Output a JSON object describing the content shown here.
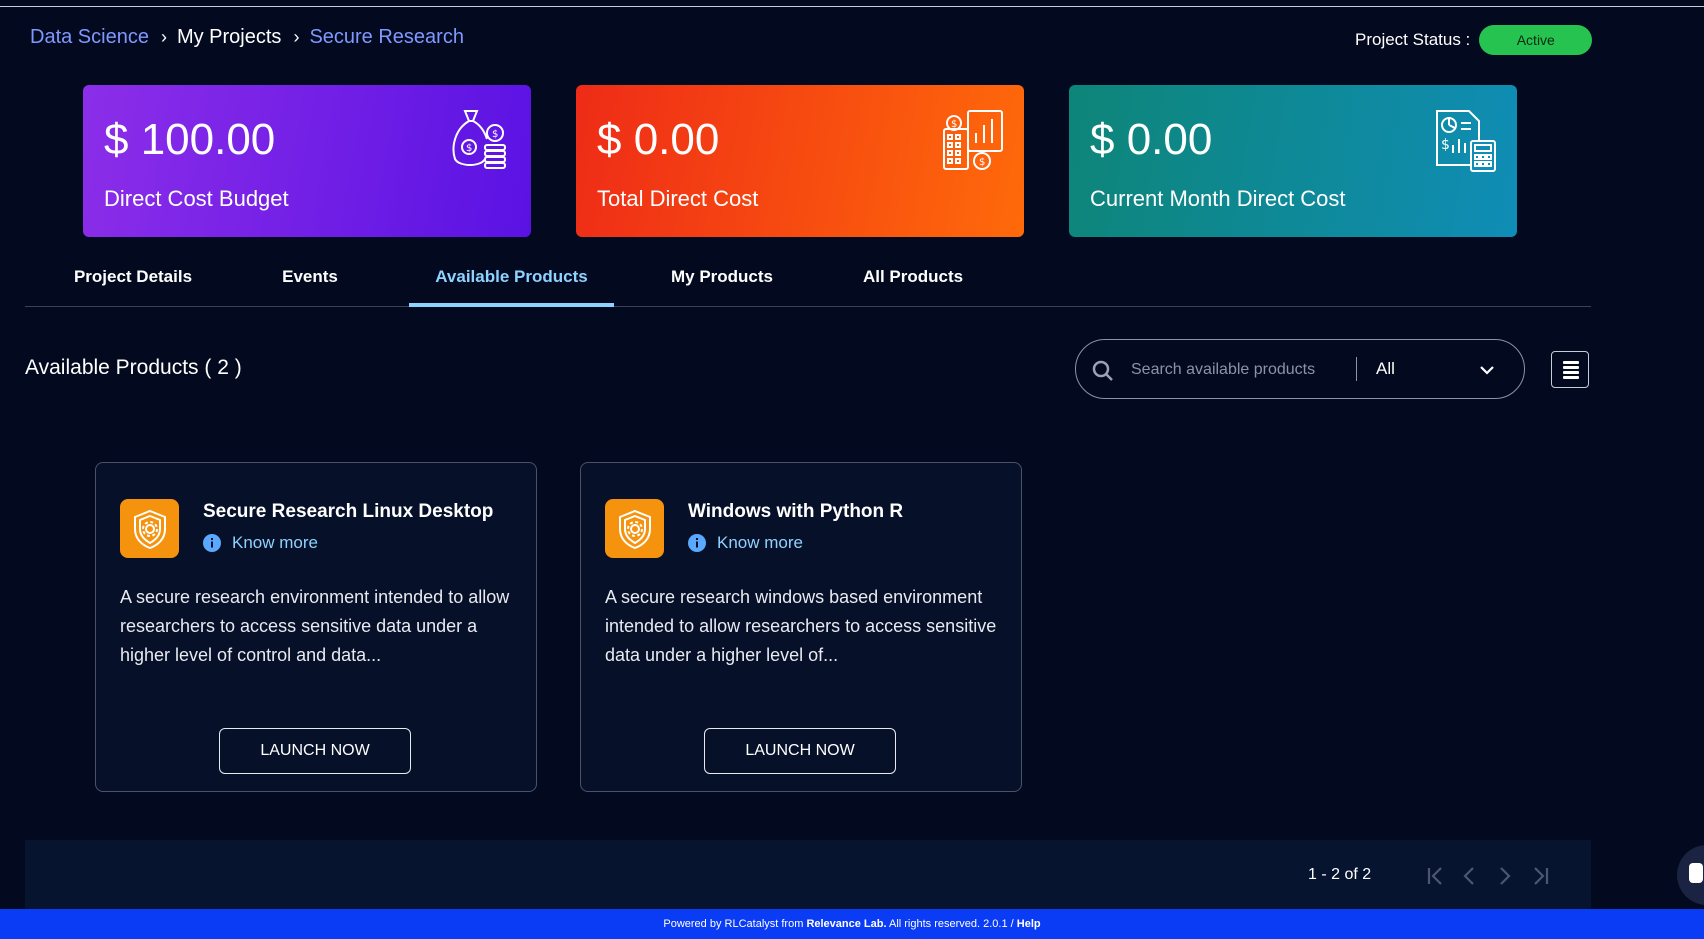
{
  "breadcrumb": {
    "item1": "Data Science",
    "item2": "My Projects",
    "item3": "Secure Research"
  },
  "status": {
    "label": "Project Status :",
    "value": "Active"
  },
  "cost_cards": [
    {
      "amount": "$ 100.00",
      "label": "Direct Cost Budget",
      "icon": "money-bag-coins-icon"
    },
    {
      "amount": "$ 0.00",
      "label": "Total Direct Cost",
      "icon": "cost-chart-building-icon"
    },
    {
      "amount": "$ 0.00",
      "label": "Current Month Direct Cost",
      "icon": "report-calculator-icon"
    }
  ],
  "tabs": [
    {
      "label": "Project Details"
    },
    {
      "label": "Events"
    },
    {
      "label": "Available Products",
      "active": true
    },
    {
      "label": "My Products"
    },
    {
      "label": "All Products"
    }
  ],
  "section": {
    "title": "Available Products ( 2 )"
  },
  "search": {
    "placeholder": "Search available products",
    "value": "",
    "filter_value": "All"
  },
  "products": [
    {
      "name": "Secure Research Linux Desktop",
      "know_more": "Know more",
      "description": "A secure research environment intended to allow researchers to access sensitive data under a higher level of control and data...",
      "launch_label": "LAUNCH NOW"
    },
    {
      "name": "Windows with Python R",
      "know_more": "Know more",
      "description": "A secure research windows based environment intended to allow researchers to access sensitive data under a higher level of...",
      "launch_label": "LAUNCH NOW"
    }
  ],
  "pagination": {
    "range": "1 - 2 of 2"
  },
  "footer": {
    "prefix": "Powered by RLCatalyst from ",
    "company": "Relevance Lab.",
    "suffix": " All rights reserved. 2.0.1 / ",
    "help": "Help"
  },
  "colors": {
    "background": "#030a1f",
    "accent": "#8ed2ff",
    "link": "#7f98ff",
    "status_active": "#27c351",
    "product_icon": "#f5930f",
    "footer": "#0a3cf5"
  }
}
